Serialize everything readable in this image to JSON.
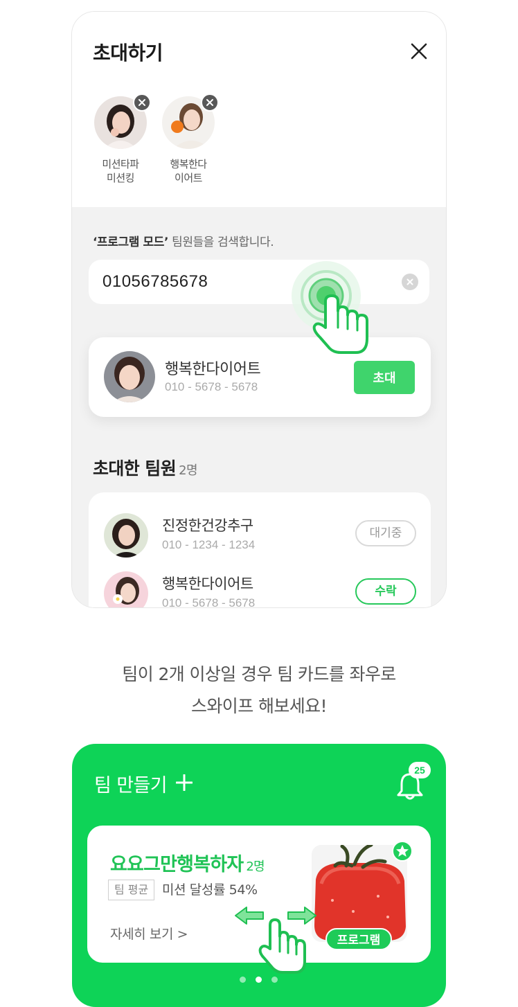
{
  "invite_modal": {
    "title": "초대하기",
    "selected_users": [
      {
        "name_line1": "미션타파",
        "name_line2": "미션킹"
      },
      {
        "name_line1": "행복한다",
        "name_line2": "이어트"
      }
    ],
    "hint_bold": "‘프로그램 모드’",
    "hint_text": " 팀원들을 검색합니다.",
    "search": {
      "value": "01056785678"
    },
    "result": {
      "name": "행복한다이어트",
      "phone": "010 - 5678 - 5678",
      "invite_label": "초대"
    },
    "members_section": {
      "title": "초대한 팀원",
      "count": "2명",
      "members": [
        {
          "name": "진정한건강추구",
          "phone": "010 - 1234 - 1234",
          "status": "대기중"
        },
        {
          "name": "행복한다이어트",
          "phone": "010 - 5678 - 5678",
          "status": "수락"
        }
      ]
    }
  },
  "caption": {
    "line1": "팀이 2개 이상일 경우 팀 카드를 좌우로",
    "line2": "스와이프 해보세요!"
  },
  "team_panel": {
    "title": "팀 만들기",
    "notification_count": "25",
    "card": {
      "team_name": "요요그만행복하자",
      "member_count": "2명",
      "avg_tag": "팀 평균",
      "avg_text": "미션 달성률 54%",
      "detail_link": "자세히 보기 >",
      "program_tag": "프로그램"
    },
    "pagination": {
      "total": 3,
      "active": 2
    }
  },
  "colors": {
    "brand_green": "#0ed357",
    "accent_green": "#20c356",
    "invite_button": "#3fd46c"
  }
}
